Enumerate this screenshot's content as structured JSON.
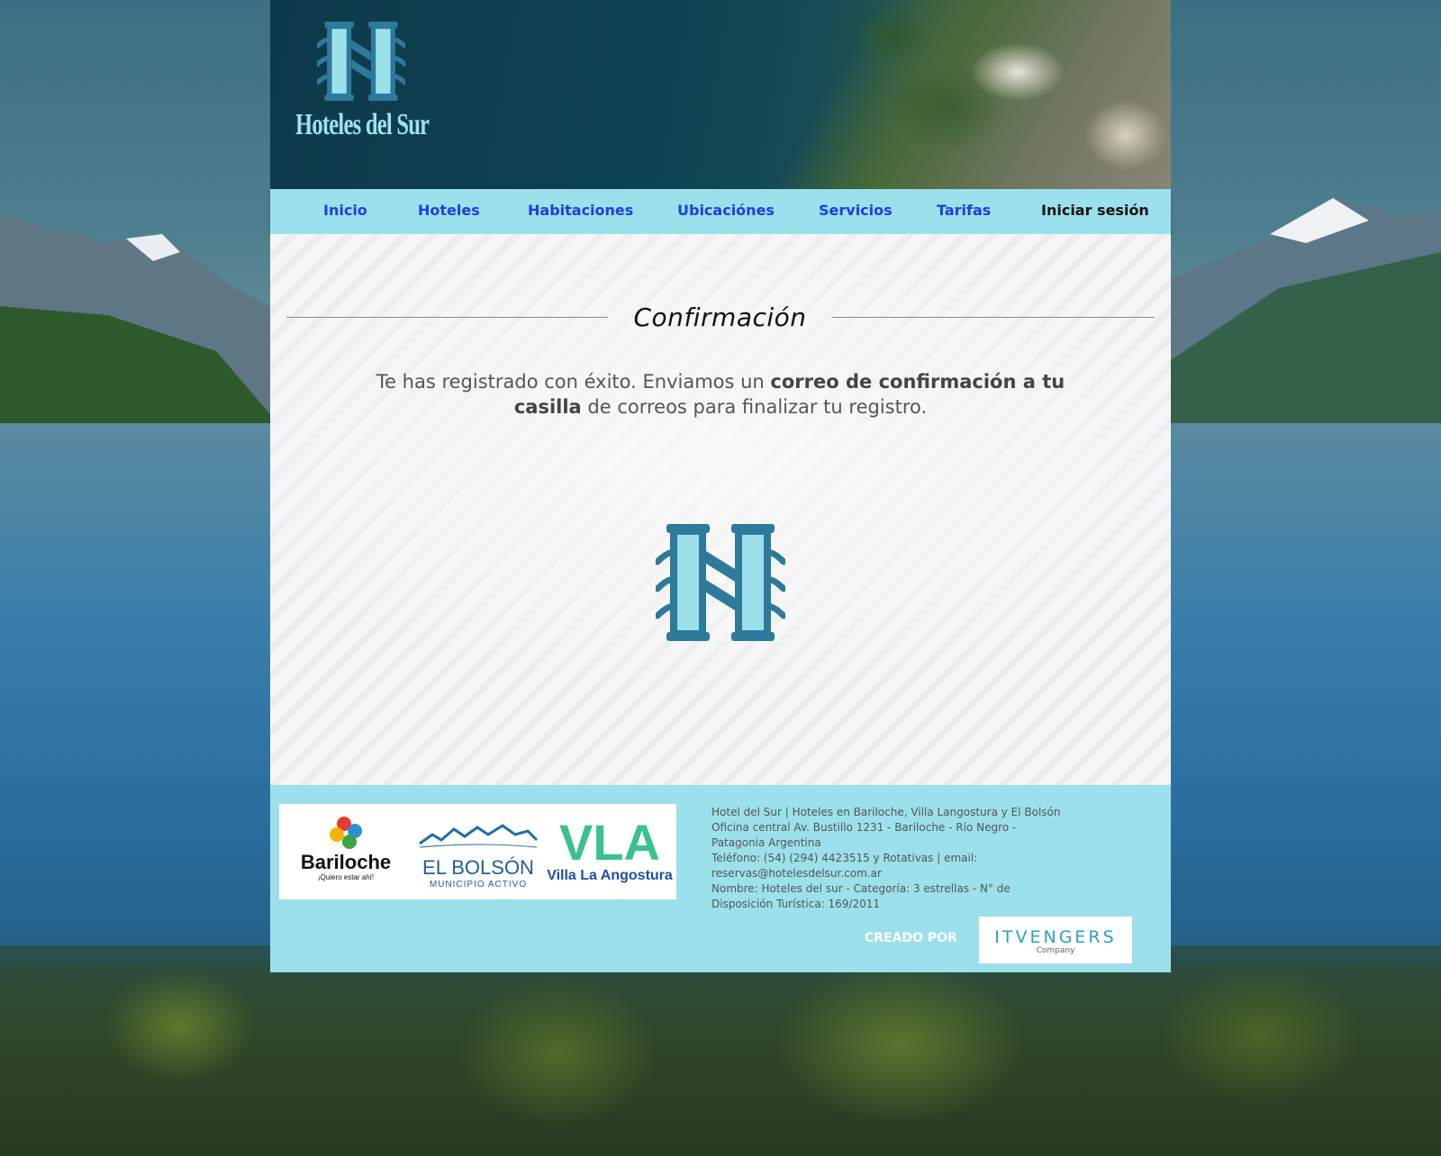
{
  "header": {
    "brand": "Hoteles del Sur"
  },
  "nav": {
    "items": [
      {
        "label": "Inicio"
      },
      {
        "label": "Hoteles"
      },
      {
        "label": "Habitaciones"
      },
      {
        "label": "Ubicaciónes"
      },
      {
        "label": "Servicios"
      },
      {
        "label": "Tarifas"
      },
      {
        "label": "Iniciar sesión"
      }
    ]
  },
  "main": {
    "title": "Confirmación",
    "message_before": "Te has registrado con éxito. Enviamos un ",
    "message_bold": "correo de confirmación a tu casilla",
    "message_after": " de correos para finalizar tu registro."
  },
  "footer": {
    "partners": {
      "bariloche": "Bariloche",
      "bariloche_tag": "¡Quiero estar ahí!",
      "bolson": "EL BOLSÓN",
      "bolson_sub": "MUNICIPIO ACTIVO",
      "vla": "VLA",
      "vla_sub": "Villa La Angostura"
    },
    "info": [
      "Hotel del Sur | Hoteles en Bariloche, Villa Langostura y El Bolsón",
      "Oficina central Av. Bustillo 1231 - Bariloche - Río Negro - Patagonia Argentina",
      "Teléfono: (54) (294) 4423515 y Rotativas | email: reservas@hotelesdelsur.com.ar",
      "Nombre: Hoteles del sur - Categoría: 3 estrellas - N° de Disposición Turística: 169/2011"
    ],
    "created_by": "CREADO POR",
    "company_name": "ITVENGERS",
    "company_sub": "Company"
  },
  "colors": {
    "nav_bg": "#9be0ea",
    "nav_link": "#1c3fe0",
    "logo_dark": "#2e7a9a",
    "logo_light": "#9be0ea"
  }
}
